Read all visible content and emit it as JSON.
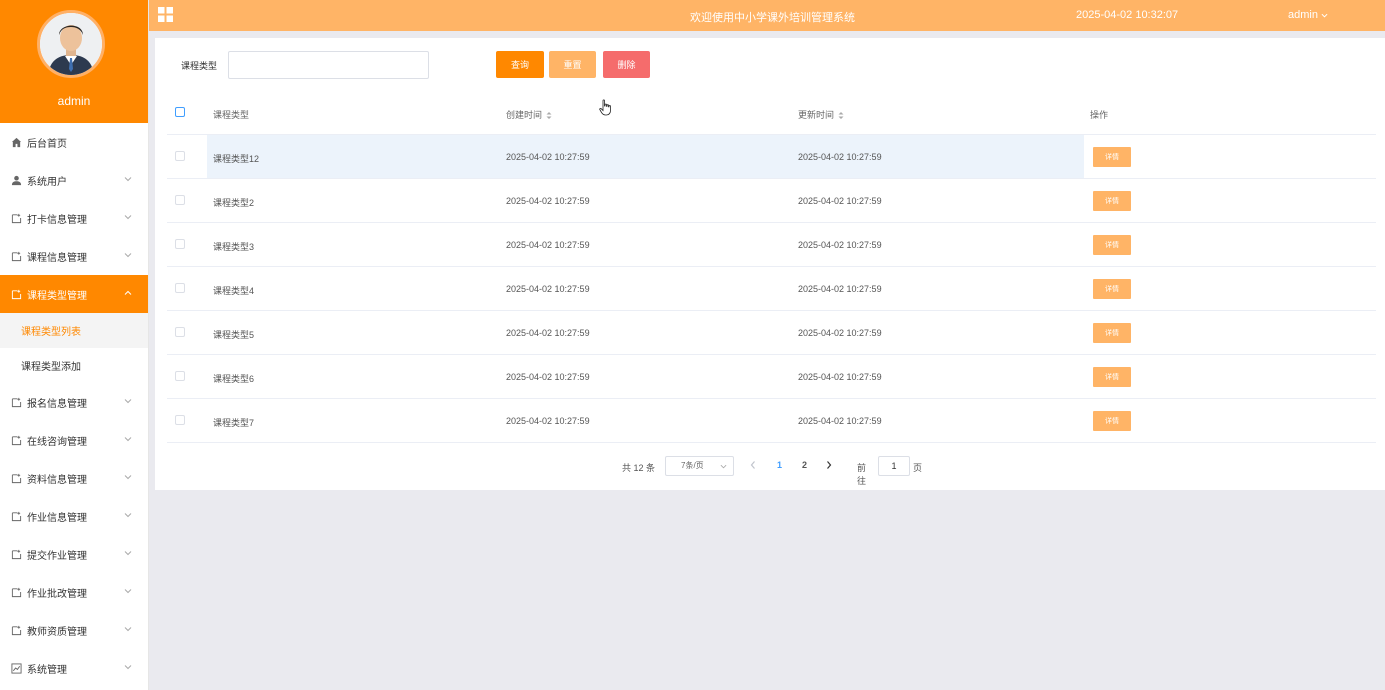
{
  "header": {
    "title": "欢迎使用中小学课外培训管理系统",
    "datetime": "2025-04-02 10:32:07",
    "user": "admin"
  },
  "sidebar": {
    "profile_name": "admin",
    "items": [
      {
        "label": "后台首页",
        "icon": "home-icon"
      },
      {
        "label": "系统用户",
        "icon": "user-icon"
      },
      {
        "label": "打卡信息管理",
        "icon": "folder-icon"
      },
      {
        "label": "课程信息管理",
        "icon": "folder-icon"
      },
      {
        "label": "课程类型管理",
        "icon": "folder-icon",
        "active": true
      },
      {
        "label": "报名信息管理",
        "icon": "folder-icon"
      },
      {
        "label": "在线咨询管理",
        "icon": "folder-icon"
      },
      {
        "label": "资料信息管理",
        "icon": "folder-icon"
      },
      {
        "label": "作业信息管理",
        "icon": "folder-icon"
      },
      {
        "label": "提交作业管理",
        "icon": "folder-icon"
      },
      {
        "label": "作业批改管理",
        "icon": "folder-icon"
      },
      {
        "label": "教师资质管理",
        "icon": "folder-icon"
      },
      {
        "label": "系统管理",
        "icon": "chart-icon"
      }
    ],
    "subitems": [
      {
        "label": "课程类型列表",
        "active": true
      },
      {
        "label": "课程类型添加"
      }
    ]
  },
  "search": {
    "label": "课程类型",
    "value": "",
    "query_label": "查询",
    "reset_label": "重置",
    "delete_label": "删除"
  },
  "table": {
    "columns": [
      "课程类型",
      "创建时间",
      "更新时间",
      "操作"
    ],
    "detail_label": "详情",
    "rows": [
      {
        "type": "课程类型12",
        "created": "2025-04-02 10:27:59",
        "updated": "2025-04-02 10:27:59"
      },
      {
        "type": "课程类型2",
        "created": "2025-04-02 10:27:59",
        "updated": "2025-04-02 10:27:59"
      },
      {
        "type": "课程类型3",
        "created": "2025-04-02 10:27:59",
        "updated": "2025-04-02 10:27:59"
      },
      {
        "type": "课程类型4",
        "created": "2025-04-02 10:27:59",
        "updated": "2025-04-02 10:27:59"
      },
      {
        "type": "课程类型5",
        "created": "2025-04-02 10:27:59",
        "updated": "2025-04-02 10:27:59"
      },
      {
        "type": "课程类型6",
        "created": "2025-04-02 10:27:59",
        "updated": "2025-04-02 10:27:59"
      },
      {
        "type": "课程类型7",
        "created": "2025-04-02 10:27:59",
        "updated": "2025-04-02 10:27:59"
      }
    ]
  },
  "pagination": {
    "total_text": "共 12 条",
    "page_size": "7条/页",
    "pages": [
      "1",
      "2"
    ],
    "current_page": "1",
    "goto_label": "前往",
    "goto_value": "1",
    "page_suffix": "页"
  },
  "colors": {
    "primary": "#ff8800",
    "topbar": "#ffb466",
    "danger": "#f56c6c"
  }
}
